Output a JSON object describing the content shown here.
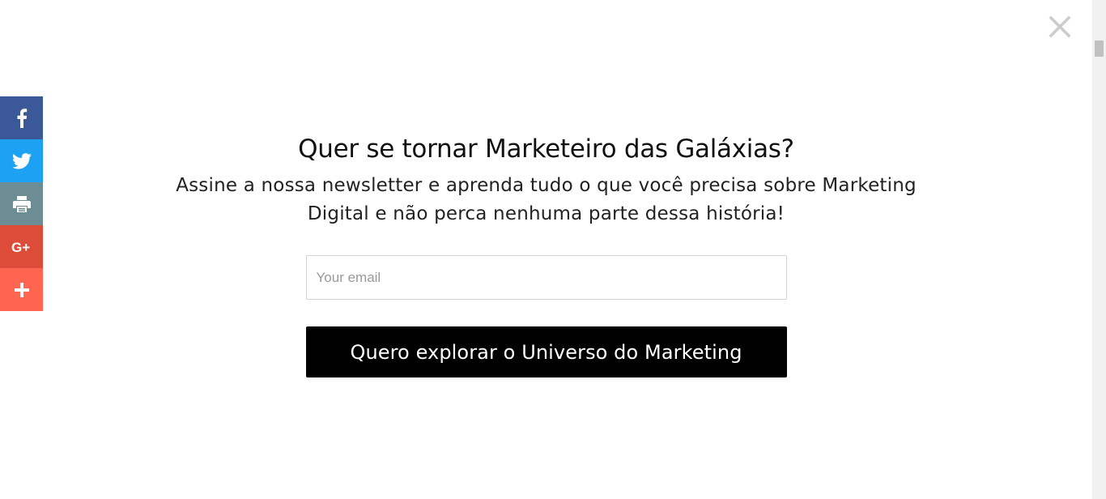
{
  "close": {
    "icon": "close-icon",
    "color": "#cccccc"
  },
  "share": {
    "items": [
      {
        "name": "facebook",
        "icon": "facebook-icon",
        "color": "#3b5998"
      },
      {
        "name": "twitter",
        "icon": "twitter-icon",
        "color": "#1da1f2"
      },
      {
        "name": "print",
        "icon": "print-icon",
        "color": "#6d8d94"
      },
      {
        "name": "google-plus",
        "icon": "google-plus-icon",
        "label": "G+",
        "color": "#dd4b39"
      },
      {
        "name": "more",
        "icon": "plus-icon",
        "color": "#ff6550"
      }
    ]
  },
  "popup": {
    "title": "Quer se tornar Marketeiro das Galáxias?",
    "subtitle": "Assine a nossa newsletter e aprenda tudo o que você precisa sobre Marketing Digital e não perca nenhuma parte dessa história!",
    "email": {
      "placeholder": "Your email",
      "value": ""
    },
    "submit_label": "Quero explorar o Universo do Marketing",
    "button_color": "#000000"
  }
}
